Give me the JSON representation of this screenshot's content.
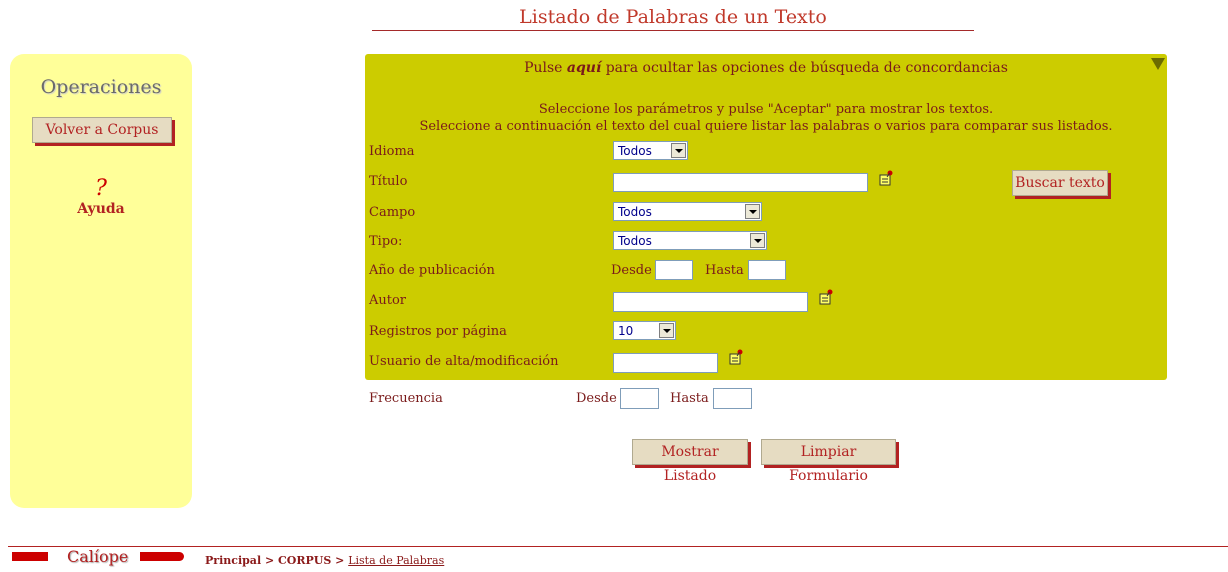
{
  "header": {
    "title": "Listado de Palabras de un Texto"
  },
  "sidebar": {
    "title": "Operaciones",
    "back_button": "Volver a Corpus",
    "help_symbol": "?",
    "help_label": "Ayuda"
  },
  "panel": {
    "toggle_prefix": "Pulse ",
    "toggle_link": "aquí",
    "toggle_suffix": " para ocultar las opciones de búsqueda de concordancias",
    "info_line_1": "Seleccione los parámetros y pulse \"Aceptar\" para mostrar los textos.",
    "info_line_2": "Seleccione a continuación el texto del cual quiere listar las palabras o varios para comparar sus listados.",
    "fields": {
      "idioma": {
        "label": "Idioma",
        "value": "Todos"
      },
      "titulo": {
        "label": "Título",
        "value": ""
      },
      "campo": {
        "label": "Campo",
        "value": "Todos"
      },
      "tipo": {
        "label": "Tipo:",
        "value": "Todos"
      },
      "anio": {
        "label": "Año de publicación",
        "desde": "Desde",
        "hasta": "Hasta"
      },
      "autor": {
        "label": "Autor",
        "value": ""
      },
      "registros": {
        "label": "Registros por página",
        "value": "10"
      },
      "usuario": {
        "label": "Usuario de alta/modificación",
        "value": ""
      }
    },
    "search_text_button": "Buscar texto"
  },
  "frequency": {
    "label": "Frecuencia",
    "desde": "Desde",
    "hasta": "Hasta"
  },
  "actions": {
    "show_list": "Mostrar Listado",
    "clear_form": "Limpiar Formulario"
  },
  "footer": {
    "brand": "Calíope",
    "breadcrumb_principal": "Principal",
    "breadcrumb_sep": " > ",
    "breadcrumb_corpus": "CORPUS",
    "breadcrumb_current": "Lista de Palabras"
  },
  "colors": {
    "sidebar_bg": "#ffff99",
    "panel_bg": "#cccc00",
    "accent": "#b22222"
  }
}
